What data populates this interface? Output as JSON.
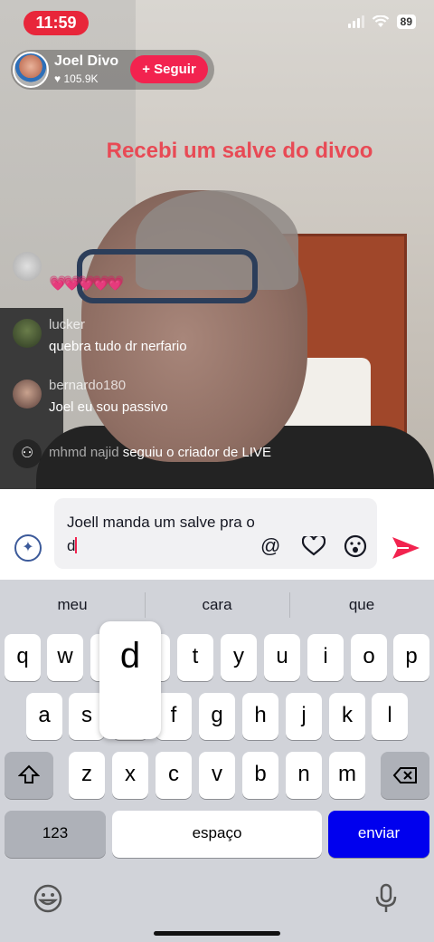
{
  "status_bar": {
    "time": "11:59",
    "battery": "89"
  },
  "host": {
    "name": "Joel Divo",
    "likes": "105.9K",
    "follow_label": "+ Seguir"
  },
  "overlay_text": "Recebi um salve do divoo",
  "comments": [
    {
      "user": "",
      "text": ""
    },
    {
      "user": "lucker",
      "text": "quebra tudo dr nerfario"
    },
    {
      "user": "bernardo180",
      "text": "Joel eu sou passivo"
    }
  ],
  "hearts": "💗💗💗💗💗",
  "follow_note": {
    "user": "mhmd najid",
    "text": "seguiu o criador de LIVE"
  },
  "input": {
    "value": "Joell manda um salve pra o d"
  },
  "keyboard": {
    "suggestions": [
      "meu",
      "cara",
      "que"
    ],
    "row1": [
      "q",
      "w",
      "e",
      "r",
      "t",
      "y",
      "u",
      "i",
      "o",
      "p"
    ],
    "row2": [
      "a",
      "s",
      "d",
      "f",
      "g",
      "h",
      "j",
      "k",
      "l"
    ],
    "row3": [
      "z",
      "x",
      "c",
      "v",
      "b",
      "n",
      "m"
    ],
    "numbers_label": "123",
    "space_label": "espaço",
    "enter_label": "enviar",
    "popup_key": "d"
  },
  "colors": {
    "brand": "#f2234f",
    "enter": "#0000ee",
    "overlay": "#e84a55"
  }
}
